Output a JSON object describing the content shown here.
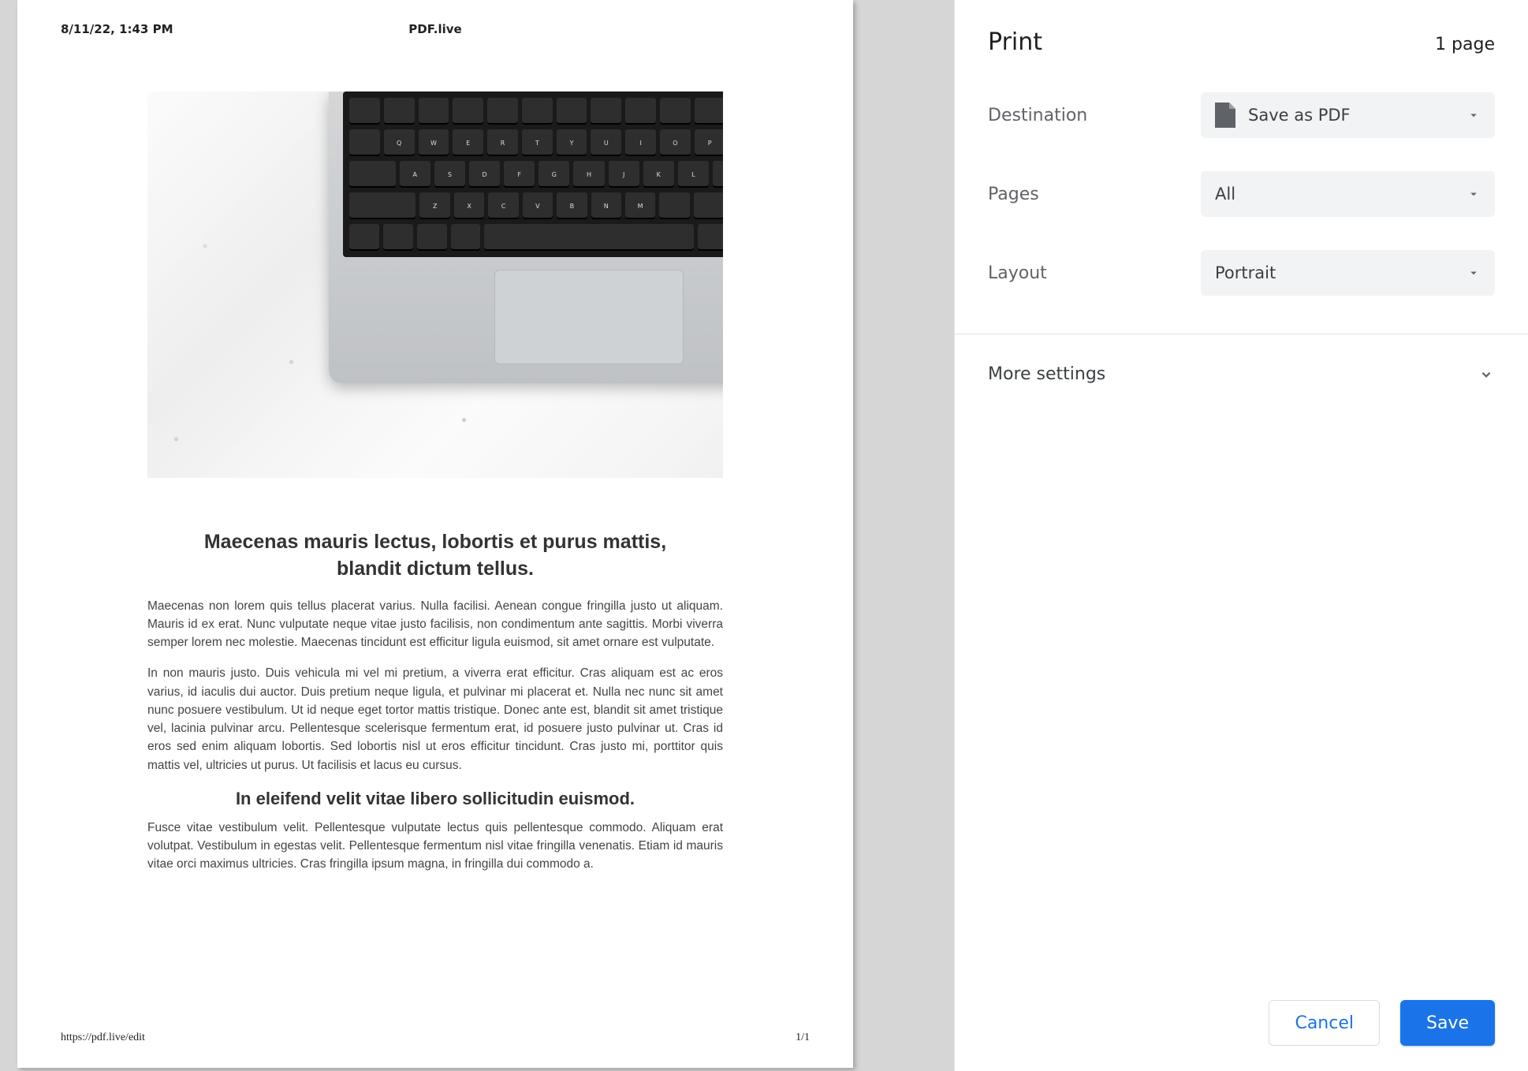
{
  "preview": {
    "header_left": "8/11/22, 1:43 PM",
    "header_center": "PDF.live",
    "footer_left": "https://pdf.live/edit",
    "footer_right": "1/1",
    "heading1": "Maecenas mauris lectus, lobortis et purus mattis, blandit dictum tellus.",
    "para1": "Maecenas non lorem quis tellus placerat varius. Nulla facilisi. Aenean congue fringilla justo ut aliquam. Mauris id ex erat. Nunc vulputate neque vitae justo facilisis, non condimentum ante sagittis. Morbi viverra semper lorem nec molestie. Maecenas tincidunt est efficitur ligula euismod, sit amet ornare est vulputate.",
    "para2": "In non mauris justo. Duis vehicula mi vel mi pretium, a viverra erat efficitur. Cras aliquam est ac eros varius, id iaculis dui auctor. Duis pretium neque ligula, et pulvinar mi placerat et. Nulla nec nunc sit amet nunc posuere vestibulum. Ut id neque eget tortor mattis tristique. Donec ante est, blandit sit amet tristique vel, lacinia pulvinar arcu. Pellentesque scelerisque fermentum erat, id posuere justo pulvinar ut. Cras id eros sed enim aliquam lobortis. Sed lobortis nisl ut eros efficitur tincidunt. Cras justo mi, porttitor quis mattis vel, ultricies ut purus. Ut facilisis et lacus eu cursus.",
    "heading2": "In eleifend velit vitae libero sollicitudin euismod.",
    "para3": "Fusce vitae vestibulum velit. Pellentesque vulputate lectus quis pellentesque commodo. Aliquam erat volutpat. Vestibulum in egestas velit. Pellentesque fermentum nisl vitae fringilla venenatis. Etiam id mauris vitae orci maximus ultricies. Cras fringilla ipsum magna, in fringilla dui commodo a."
  },
  "panel": {
    "title": "Print",
    "page_count": "1 page",
    "rows": {
      "destination_label": "Destination",
      "destination_value": "Save as PDF",
      "pages_label": "Pages",
      "pages_value": "All",
      "layout_label": "Layout",
      "layout_value": "Portrait"
    },
    "more_settings": "More settings",
    "cancel": "Cancel",
    "save": "Save"
  }
}
